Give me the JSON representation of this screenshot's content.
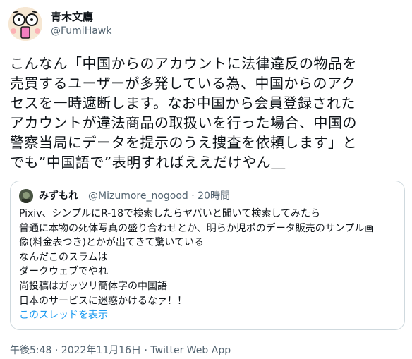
{
  "author": {
    "display_name": "青木文鷹",
    "handle": "@FumiHawk"
  },
  "tweet": {
    "lines": [
      "こんなん「中国からのアカウントに法律違反の物品を",
      "売買するユーザーが多発している為、中国からのアク",
      "セスを一時遮断します。なお中国から会員登録された",
      "アカウントが違法商品の取扱いを行った場合、中国の",
      "警察当局にデータを提示のうえ捜査を依頼します」と",
      "でも”中国語で”表明すればええだけやん＿"
    ]
  },
  "quote": {
    "display_name": "みずもれ",
    "meta": "@Mizumore_nogood · 20時間",
    "lines": [
      "Pixiv、シンプルにR-18で検索したらヤバいと聞いて検索してみたら",
      "普通に本物の死体写真の盛り合わせとか、明らか児ポのデータ販売のサンプル画",
      "像(料金表つき)とかが出てきて驚いている",
      "なんだこのスラムは",
      "ダークウェブでやれ",
      "尚投稿はガッツリ簡体字の中国語",
      "日本のサービスに迷惑かけるなァ！！"
    ],
    "thread_link": "このスレッドを表示"
  },
  "footer": {
    "timestamp": "午後5:48 · 2022年11月16日 · Twitter Web App"
  },
  "colors": {
    "link": "#1d9bf0",
    "secondary_text": "#536471",
    "border": "#cfd9de"
  }
}
